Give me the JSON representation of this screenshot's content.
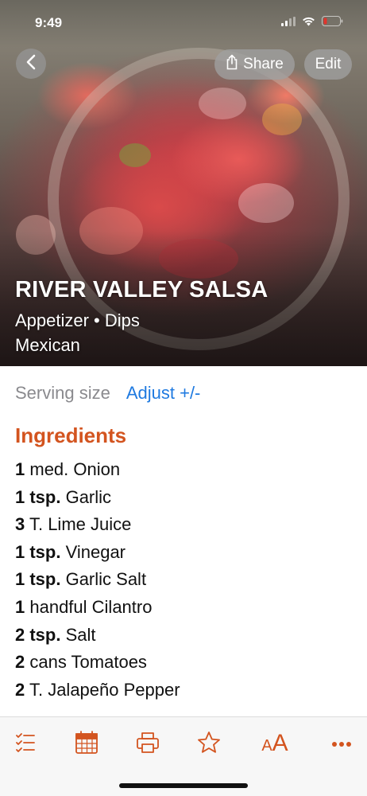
{
  "status_bar": {
    "time": "9:49",
    "icons": [
      "signal-icon",
      "wifi-icon",
      "battery-low-icon"
    ],
    "battery_color": "#e0342c"
  },
  "nav": {
    "back_icon": "chevron-left-icon",
    "share_label": "Share",
    "share_icon": "share-icon",
    "edit_label": "Edit"
  },
  "recipe": {
    "title": "RIVER VALLEY SALSA",
    "category_line1": "Appetizer • Dips",
    "category_line2": "Mexican"
  },
  "serving": {
    "label": "Serving size",
    "adjust_label": "Adjust +/-"
  },
  "ingredients": {
    "heading": "Ingredients",
    "items": [
      {
        "qty": "1",
        "text": " med. Onion"
      },
      {
        "qty": "1 tsp.",
        "text": " Garlic"
      },
      {
        "qty": "3",
        "text": " T. Lime Juice"
      },
      {
        "qty": "1 tsp.",
        "text": " Vinegar"
      },
      {
        "qty": "1 tsp.",
        "text": " Garlic Salt"
      },
      {
        "qty": "1",
        "text": " handful Cilantro"
      },
      {
        "qty": "2 tsp.",
        "text": " Salt"
      },
      {
        "qty": "2",
        "text": " cans Tomatoes"
      },
      {
        "qty": "2",
        "text": " T. Jalapeño Pepper"
      }
    ]
  },
  "toolbar": {
    "accent_color": "#d3541f",
    "font_size_label": "AA",
    "icons": [
      "checklist-icon",
      "calendar-icon",
      "print-icon",
      "star-icon",
      "font-size-icon",
      "more-icon"
    ]
  },
  "colors": {
    "accent": "#d3541f",
    "link": "#1f7ae0",
    "muted": "#8a8a8e"
  }
}
